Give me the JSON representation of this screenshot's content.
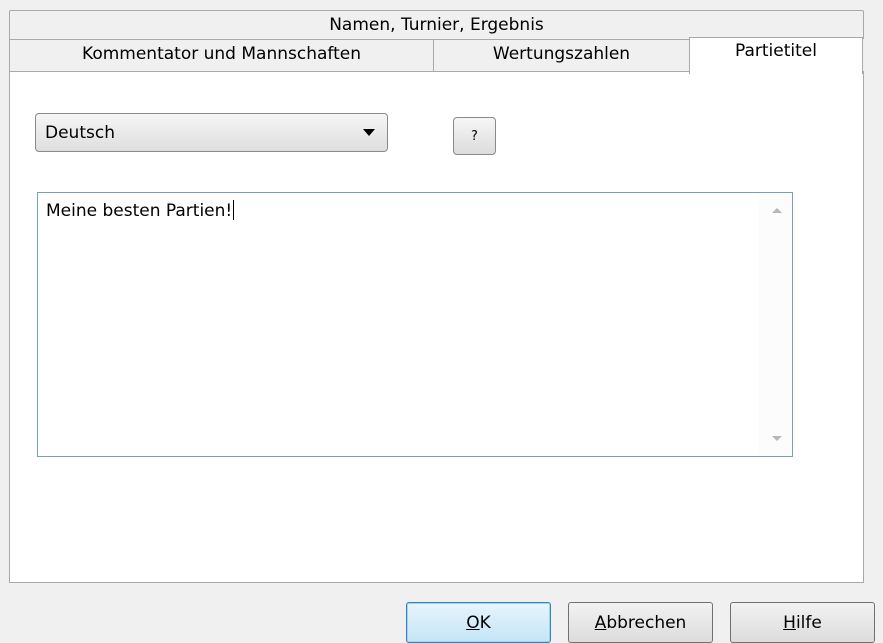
{
  "tabs": {
    "back_row": [
      "Namen, Turnier, Ergebnis"
    ],
    "front_row": [
      "Kommentator und Mannschaften",
      "Wertungszahlen",
      "Partietitel"
    ],
    "active": "Partietitel"
  },
  "language": {
    "selected": "Deutsch"
  },
  "help_button_label": "?",
  "title_text": "Meine besten Partien!",
  "buttons": {
    "ok_mnemonic": "O",
    "ok_rest": "K",
    "cancel_mnemonic": "A",
    "cancel_rest": "bbrechen",
    "help_mnemonic": "H",
    "help_rest": "ilfe"
  },
  "colors": {
    "dialog_bg": "#f0f0f0",
    "page_bg": "#ffffff",
    "default_button_border": "#3c7fb1",
    "textbox_border": "#7a9ccc"
  }
}
